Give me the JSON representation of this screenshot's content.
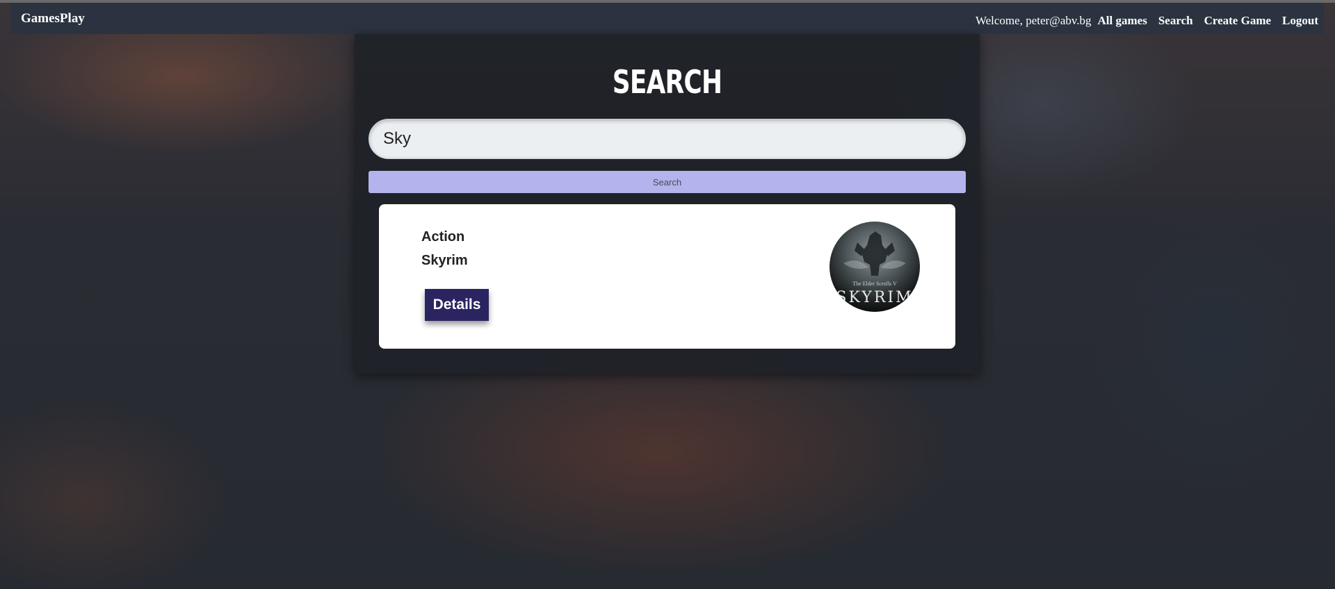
{
  "navbar": {
    "brand": "GamesPlay",
    "welcome": "Welcome, peter@abv.bg",
    "links": [
      "All games",
      "Search",
      "Create Game",
      "Logout"
    ]
  },
  "search": {
    "title": "SEARCH",
    "input_value": "Sky",
    "button_label": "Search"
  },
  "results": [
    {
      "genre": "Action",
      "title": "Skyrim",
      "details_label": "Details",
      "image_text": {
        "subtitle": "The Elder Scrolls V",
        "logo": "SKYRIM"
      }
    }
  ],
  "colors": {
    "navbar_bg": "#2b3340",
    "search_button_bg": "#b3b4ed",
    "details_button_bg": "#2a2560",
    "card_bg": "#ffffff"
  },
  "icons": {
    "game_cover": "skyrim-cover-image"
  }
}
